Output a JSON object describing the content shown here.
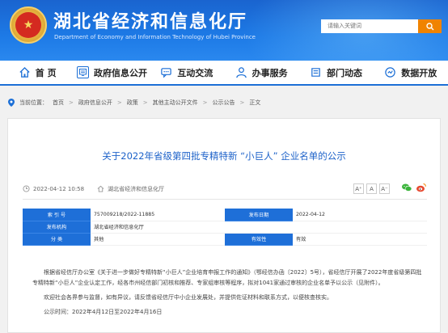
{
  "header": {
    "title": "湖北省经济和信息化厅",
    "subtitle": "Department of Economy and Information Technology of Hubei Province",
    "search_placeholder": "请输入关键词",
    "emblem_icon": "national-emblem-icon",
    "colors": {
      "primary": "#1d7ae6",
      "search_button": "#f08300",
      "title_link": "#1d62c9"
    }
  },
  "nav": {
    "items": [
      {
        "label": "首 页",
        "icon": "home-icon"
      },
      {
        "label": "政府信息公开",
        "icon": "info-disclosure-icon"
      },
      {
        "label": "互动交流",
        "icon": "chat-icon"
      },
      {
        "label": "办事服务",
        "icon": "service-icon"
      },
      {
        "label": "部门动态",
        "icon": "news-icon"
      },
      {
        "label": "数据开放",
        "icon": "data-icon"
      }
    ]
  },
  "breadcrumb": {
    "prefix": "当前位置：",
    "items": [
      "首页",
      "政府信息公开",
      "政策",
      "其他主动公开文件",
      "公示公告",
      "正文"
    ],
    "separator": ">"
  },
  "article": {
    "title": "关于2022年省级第四批专精特新 “小巨人” 企业名单的公示",
    "datetime": "2022-04-12 10:58",
    "source": "湖北省经济和信息化厅",
    "font_sizes": [
      "A⁺",
      "A",
      "A⁻"
    ],
    "share_icons": [
      "wechat-icon",
      "weibo-icon"
    ]
  },
  "info_table": [
    [
      "索 引 号",
      "757009218/2022-11885",
      "发布日期",
      "2022-04-12"
    ],
    [
      "发布机构",
      "湖北省经济和信息化厅",
      "",
      ""
    ],
    [
      "分 类",
      "其他",
      "有效性",
      "有效"
    ]
  ],
  "body": {
    "paragraphs": [
      "根据省经信厅办公室《关于进一步做好专精特新“小巨人”企业培育申报工作的通知》（鄂经信办函〔2022〕5号），省经信厅开展了2022年度省级第四批专精特新“小巨人”企业认定工作，经各市州经信部门初核和推荐、专家组审核等程序，拟对1041家通过审核的企业名单予以公示（见附件）。",
      "欢迎社会各界参与监督，如有异议，请反馈省经信厅中小企业发展处，并提供佐证材料和联系方式，以便核查核实。",
      "公示时间：2022年4月12日至2022年4月16日"
    ]
  }
}
